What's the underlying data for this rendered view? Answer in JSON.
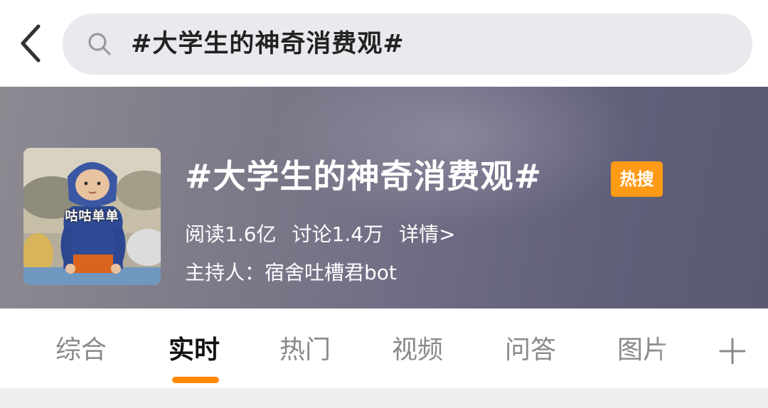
{
  "header": {
    "back_icon": "chevron-left-icon",
    "search_icon": "search-icon",
    "search_query": "#大学生的神奇消费观#"
  },
  "topic": {
    "title": "#大学生的神奇消费观#",
    "badge": "热搜",
    "badge_color": "#ff9a16",
    "image_caption": "咕咕单单",
    "reads": "阅读1.6亿",
    "discussions": "讨论1.4万",
    "details_link": "详情>",
    "host": "主持人：宿舍吐槽君bot"
  },
  "tabs": {
    "items": [
      {
        "label": "综合"
      },
      {
        "label": "实时"
      },
      {
        "label": "热门"
      },
      {
        "label": "视频"
      },
      {
        "label": "问答"
      },
      {
        "label": "图片"
      }
    ],
    "active_index": 1,
    "accent_color": "#ff8a00",
    "add_icon": "plus-icon"
  }
}
